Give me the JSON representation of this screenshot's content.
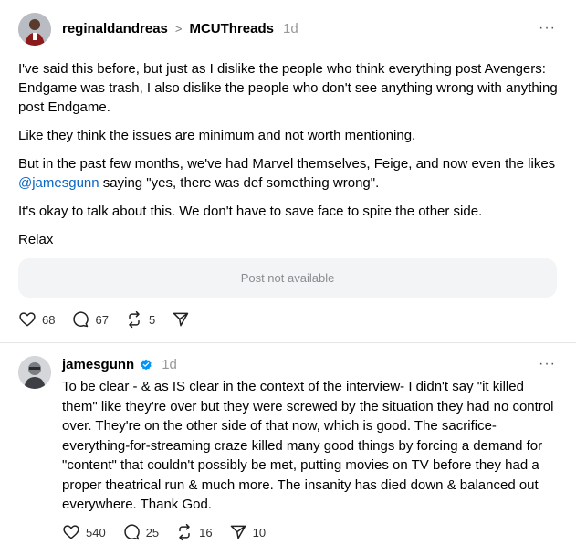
{
  "post1": {
    "username": "reginaldandreas",
    "separator": ">",
    "community": "MCUThreads",
    "time": "1d",
    "more": "···",
    "paragraphs": [
      "I've said this before, but just as I dislike the people who think everything post Avengers: Endgame was trash, I also dislike the people who don't see anything wrong with anything post Endgame.",
      "Like they think the issues are minimum and not worth mentioning."
    ],
    "para3_before": "But in the past few months, we've had Marvel themselves, Feige, and now even the likes ",
    "para3_mention": "@jamesgunn",
    "para3_after": " saying \"yes, there was def something wrong\".",
    "para4": "It's okay to talk about this. We don't have to save face to spite the other side.",
    "para5": "Relax",
    "embed_text": "Post not available",
    "likes": "68",
    "replies": "67",
    "reposts": "5"
  },
  "post2": {
    "username": "jamesgunn",
    "time": "1d",
    "more": "···",
    "text": "To be clear - & as IS clear in the context of the interview- I didn't say \"it killed them\" like they're over but they were screwed by the situation they had no control over. They're on the other side of that now, which is good. The sacrifice-everything-for-streaming craze killed many good things by forcing a demand for \"content\" that couldn't possibly be met, putting movies on TV before they had a proper theatrical run & much more. The insanity has died down & balanced out everywhere. Thank God.",
    "likes": "540",
    "replies": "25",
    "reposts": "16",
    "shares": "10"
  },
  "colors": {
    "link": "#0a66c2",
    "verified": "#0095f6"
  }
}
